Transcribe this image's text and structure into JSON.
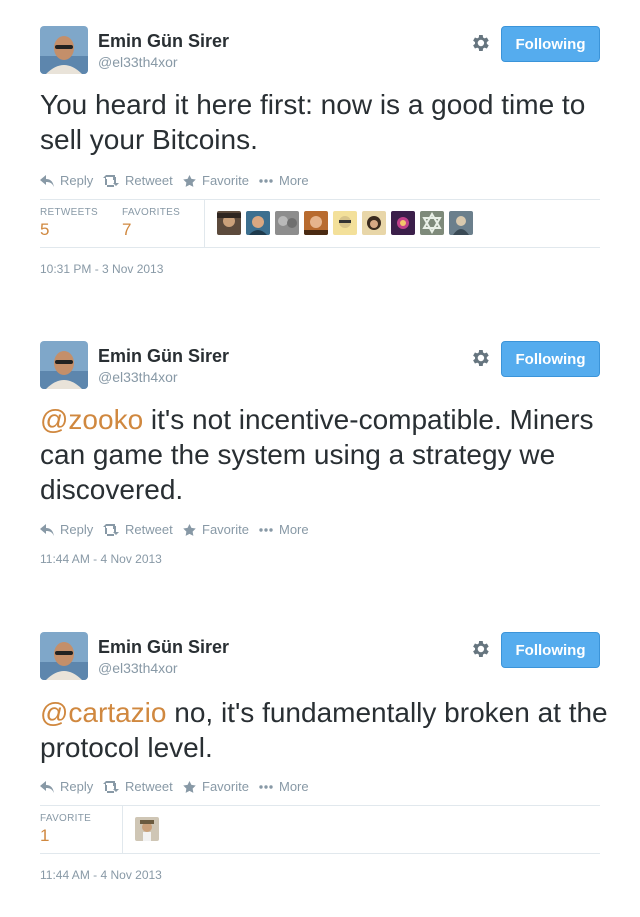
{
  "tweets": [
    {
      "author": {
        "name": "Emin Gün Sirer",
        "handle": "@el33th4xor"
      },
      "follow_label": "Following",
      "mention": "",
      "text": "You heard it here first: now is a good time to sell your Bitcoins.",
      "actions": {
        "reply": "Reply",
        "retweet": "Retweet",
        "favorite": "Favorite",
        "more": "More"
      },
      "stats": {
        "retweets_label": "RETWEETS",
        "retweets": "5",
        "favorites_label": "FAVORITES",
        "favorites": "7"
      },
      "favoriters": [
        "favoriter-1",
        "favoriter-2",
        "favoriter-3",
        "favoriter-4",
        "favoriter-5",
        "favoriter-6",
        "favoriter-7",
        "favoriter-8",
        "favoriter-9"
      ],
      "timestamp": "10:31 PM - 3 Nov 2013"
    },
    {
      "author": {
        "name": "Emin Gün Sirer",
        "handle": "@el33th4xor"
      },
      "follow_label": "Following",
      "mention": "@zooko",
      "text": " it's not incentive-compatible. Miners can game the system using a strategy we discovered.",
      "actions": {
        "reply": "Reply",
        "retweet": "Retweet",
        "favorite": "Favorite",
        "more": "More"
      },
      "timestamp": "11:44 AM - 4 Nov 2013"
    },
    {
      "author": {
        "name": "Emin Gün Sirer",
        "handle": "@el33th4xor"
      },
      "follow_label": "Following",
      "mention": "@cartazio",
      "text": " no, it's fundamentally broken at the protocol level.",
      "actions": {
        "reply": "Reply",
        "retweet": "Retweet",
        "favorite": "Favorite",
        "more": "More"
      },
      "stats": {
        "favorites_label": "FAVORITE",
        "favorites": "1"
      },
      "favoriters": [
        "favoriter-1"
      ],
      "timestamp": "11:44 AM - 4 Nov 2013"
    }
  ],
  "colors": {
    "follow_button": "#55acee",
    "mention": "#d0883f",
    "count": "#d0883f",
    "muted": "#8899a6",
    "text": "#292f33"
  }
}
